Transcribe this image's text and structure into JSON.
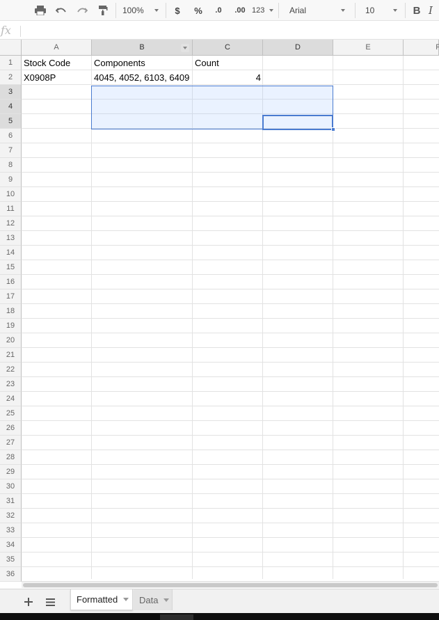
{
  "toolbar": {
    "zoom": "100%",
    "currency": "$",
    "percent": "%",
    "decimal_decrease": ".0",
    "decimal_increase": ".00",
    "more_formats": "123",
    "font": "Arial",
    "font_size": "10",
    "bold": "B",
    "italic": "I",
    "icons": [
      "print-icon",
      "undo-icon",
      "redo-icon",
      "paint-format-icon"
    ]
  },
  "formula_bar": {
    "fx_label": "fx",
    "value": ""
  },
  "columns": [
    "A",
    "B",
    "C",
    "D",
    "E",
    "F"
  ],
  "rows": [
    "1",
    "2",
    "3",
    "4",
    "5",
    "6",
    "7",
    "8",
    "9",
    "10",
    "11",
    "12",
    "13",
    "14",
    "15",
    "16",
    "17",
    "18",
    "19",
    "20",
    "21",
    "22",
    "23",
    "24",
    "25",
    "26",
    "27",
    "28",
    "29",
    "30",
    "31",
    "32",
    "33",
    "34",
    "35",
    "36"
  ],
  "cells": {
    "A1": "Stock Code",
    "B1": "Components",
    "C1": "Count",
    "A2": "X0908P",
    "B2": "4045, 4052, 6103, 6409",
    "C2": "4"
  },
  "selection": {
    "range": "B3:D5",
    "active_cell": "D5"
  },
  "sheet_tabs": [
    {
      "label": "Formatted",
      "active": true
    },
    {
      "label": "Data",
      "active": false
    }
  ],
  "tab_controls": [
    "add-sheet-icon",
    "all-sheets-icon"
  ]
}
